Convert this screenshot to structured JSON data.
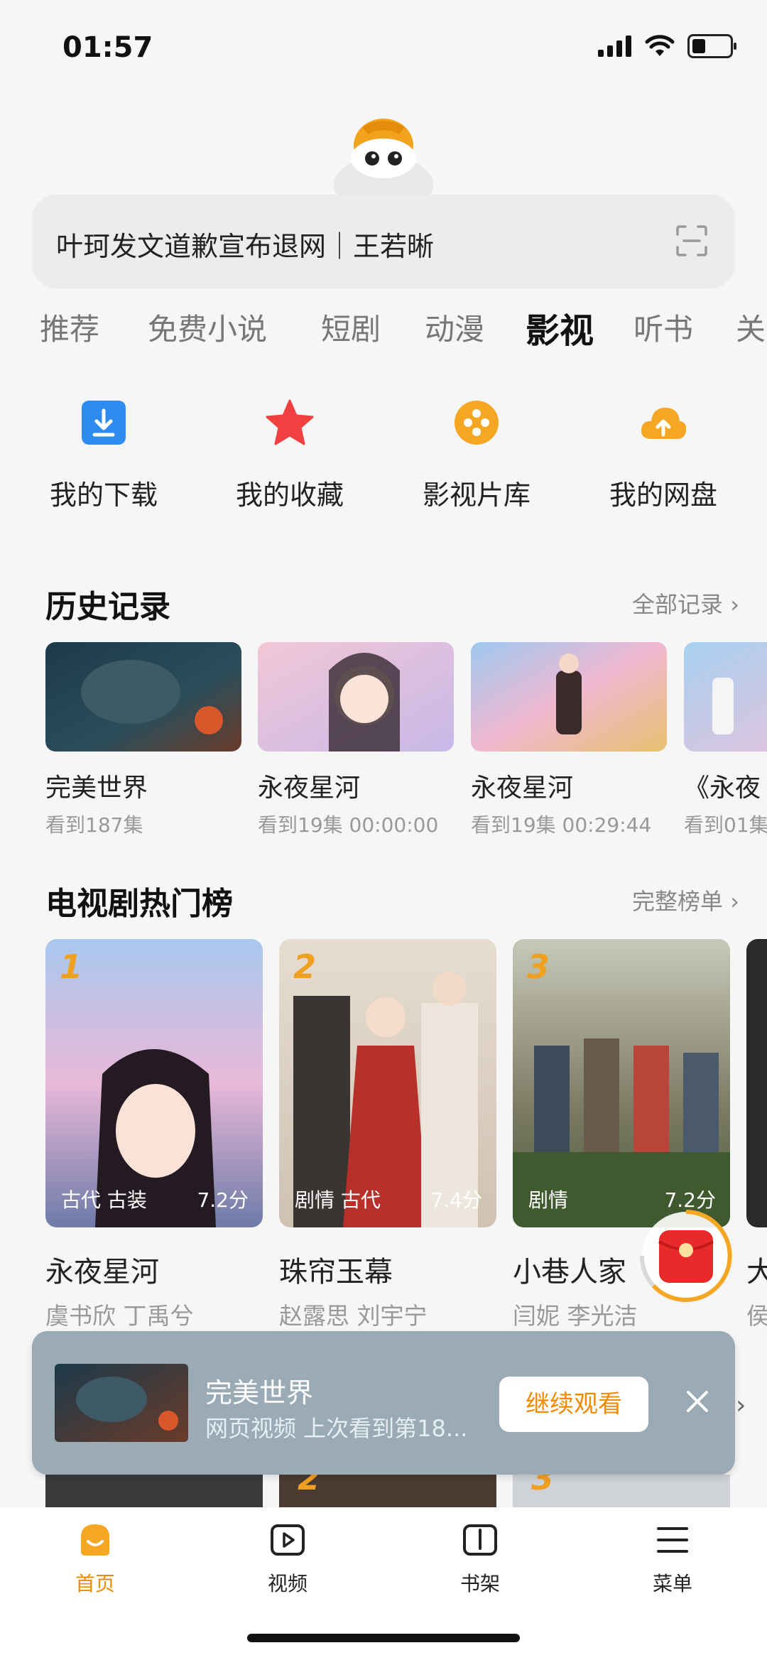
{
  "status_bar": {
    "time": "01:57"
  },
  "search": {
    "query": "叶珂发文道歉宣布退网｜王若晰"
  },
  "tabs": [
    "推荐",
    "免费小说",
    "短剧",
    "动漫",
    "影视",
    "听书",
    "关"
  ],
  "active_tab": "影视",
  "tools": [
    {
      "label": "我的下载",
      "icon": "download-icon"
    },
    {
      "label": "我的收藏",
      "icon": "star-icon"
    },
    {
      "label": "影视片库",
      "icon": "film-reel-icon"
    },
    {
      "label": "我的网盘",
      "icon": "cloud-upload-icon"
    }
  ],
  "history": {
    "title": "历史记录",
    "more": "全部记录",
    "items": [
      {
        "name": "完美世界",
        "progress": "看到187集"
      },
      {
        "name": "永夜星河",
        "progress": "看到19集 00:00:00"
      },
      {
        "name": "永夜星河",
        "progress": "看到19集 00:29:44"
      },
      {
        "name": "《永夜",
        "progress": "看到01集"
      }
    ]
  },
  "ranking": {
    "title": "电视剧热门榜",
    "more": "完整榜单",
    "items": [
      {
        "rank": "1",
        "name": "永夜星河",
        "actors": "虞书欣 丁禹兮",
        "tags": "古代 古装",
        "score": "7.2分"
      },
      {
        "rank": "2",
        "name": "珠帘玉幕",
        "actors": "赵露思 刘宇宁",
        "tags": "剧情 古代",
        "score": "7.4分"
      },
      {
        "rank": "3",
        "name": "小巷人家",
        "actors": "闫妮 李光洁",
        "tags": "剧情",
        "score": "7.2分"
      },
      {
        "rank": "",
        "name": "大",
        "actors": "侯",
        "tags": "",
        "score": ""
      }
    ]
  },
  "next_ranks": [
    "2",
    "3"
  ],
  "continue_watching": {
    "title": "完美世界",
    "subtitle": "网页视频 上次看到第18...",
    "button": "继续观看"
  },
  "tabbar": [
    {
      "label": "首页",
      "icon": "home-icon",
      "active": true
    },
    {
      "label": "视频",
      "icon": "video-play-icon",
      "active": false
    },
    {
      "label": "书架",
      "icon": "bookshelf-icon",
      "active": false
    },
    {
      "label": "菜单",
      "icon": "menu-icon",
      "active": false
    }
  ],
  "colors": {
    "accent": "#f08a00",
    "background": "#f6f6f7"
  }
}
